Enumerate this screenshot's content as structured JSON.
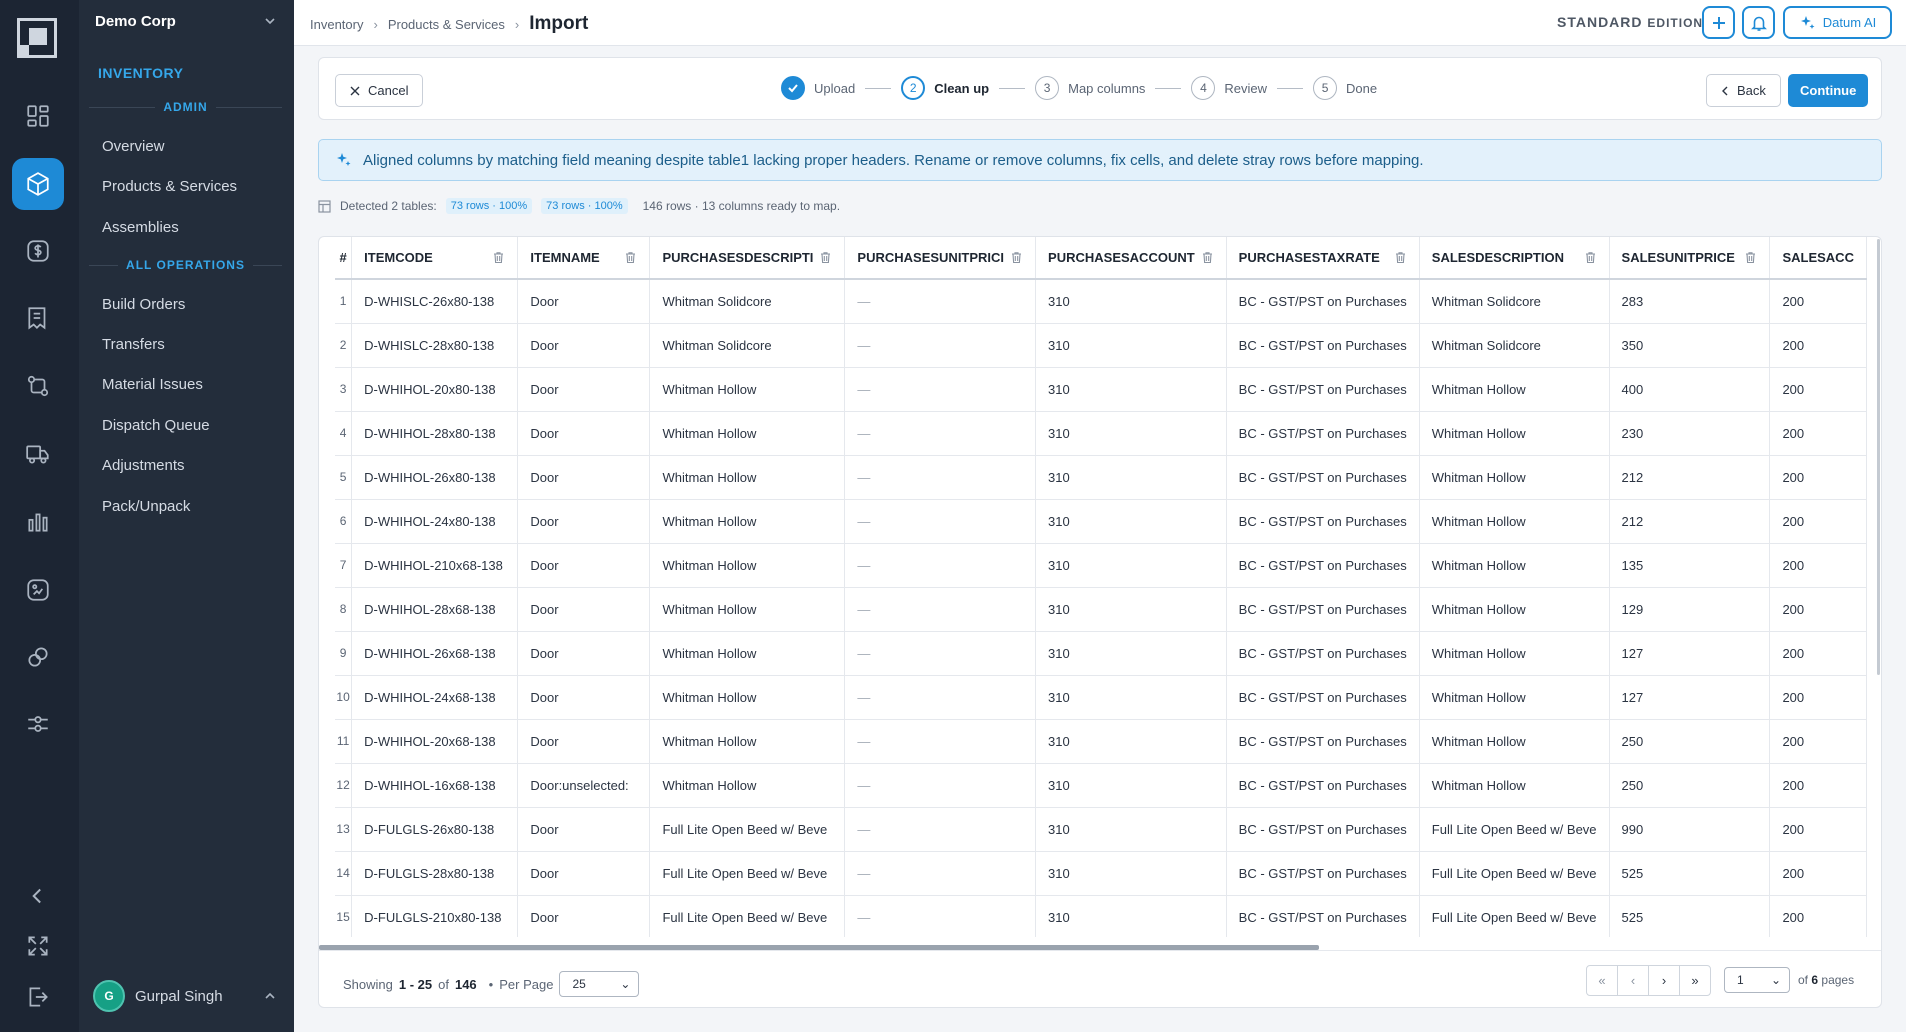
{
  "app": {
    "org": "Demo Corp",
    "section": "INVENTORY",
    "edition": "STANDARD",
    "edition_suffix": "EDITION",
    "ai_label": "Datum AI"
  },
  "user": {
    "initial": "G",
    "name": "Gurpal Singh"
  },
  "nav": {
    "admin_heading": "ADMIN",
    "admin_items": [
      "Overview",
      "Products & Services",
      "Assemblies"
    ],
    "ops_heading": "ALL OPERATIONS",
    "ops_items": [
      "Build Orders",
      "Transfers",
      "Material Issues",
      "Dispatch Queue",
      "Adjustments",
      "Pack/Unpack"
    ]
  },
  "breadcrumb": [
    "Inventory",
    "Products & Services",
    "Import"
  ],
  "wizard": {
    "cancel": "Cancel",
    "back": "Back",
    "continue": "Continue",
    "steps": [
      {
        "num": "",
        "label": "Upload"
      },
      {
        "num": "2",
        "label": "Clean up"
      },
      {
        "num": "3",
        "label": "Map columns"
      },
      {
        "num": "4",
        "label": "Review"
      },
      {
        "num": "5",
        "label": "Done"
      }
    ]
  },
  "banner": "Aligned columns by matching field meaning despite table1 lacking proper headers. Rename or remove columns, fix cells, and delete stray rows before mapping.",
  "detect": {
    "label": "Detected 2 tables:",
    "pill1": "73 rows · 100%",
    "pill2": "73 rows · 100%",
    "summary": "146 rows · 13 columns ready to map."
  },
  "table": {
    "columns": [
      "#",
      "ITEMCODE",
      "ITEMNAME",
      "PURCHASESDESCRIPTI",
      "PURCHASESUNITPRICI",
      "PURCHASESACCOUNT",
      "PURCHASESTAXRATE",
      "SALESDESCRIPTION",
      "SALESUNITPRICE",
      "SALESACC"
    ],
    "rows": [
      [
        "1",
        "D-WHISLC-26x80-138",
        "Door",
        "Whitman Solidcore",
        "—",
        "310",
        "BC - GST/PST on Purchases",
        "Whitman Solidcore",
        "283",
        "200"
      ],
      [
        "2",
        "D-WHISLC-28x80-138",
        "Door",
        "Whitman Solidcore",
        "—",
        "310",
        "BC - GST/PST on Purchases",
        "Whitman Solidcore",
        "350",
        "200"
      ],
      [
        "3",
        "D-WHIHOL-20x80-138",
        "Door",
        "Whitman Hollow",
        "—",
        "310",
        "BC - GST/PST on Purchases",
        "Whitman Hollow",
        "400",
        "200"
      ],
      [
        "4",
        "D-WHIHOL-28x80-138",
        "Door",
        "Whitman Hollow",
        "—",
        "310",
        "BC - GST/PST on Purchases",
        "Whitman Hollow",
        "230",
        "200"
      ],
      [
        "5",
        "D-WHIHOL-26x80-138",
        "Door",
        "Whitman Hollow",
        "—",
        "310",
        "BC - GST/PST on Purchases",
        "Whitman Hollow",
        "212",
        "200"
      ],
      [
        "6",
        "D-WHIHOL-24x80-138",
        "Door",
        "Whitman Hollow",
        "—",
        "310",
        "BC - GST/PST on Purchases",
        "Whitman Hollow",
        "212",
        "200"
      ],
      [
        "7",
        "D-WHIHOL-210x68-138",
        "Door",
        "Whitman Hollow",
        "—",
        "310",
        "BC - GST/PST on Purchases",
        "Whitman Hollow",
        "135",
        "200"
      ],
      [
        "8",
        "D-WHIHOL-28x68-138",
        "Door",
        "Whitman Hollow",
        "—",
        "310",
        "BC - GST/PST on Purchases",
        "Whitman Hollow",
        "129",
        "200"
      ],
      [
        "9",
        "D-WHIHOL-26x68-138",
        "Door",
        "Whitman Hollow",
        "—",
        "310",
        "BC - GST/PST on Purchases",
        "Whitman Hollow",
        "127",
        "200"
      ],
      [
        "10",
        "D-WHIHOL-24x68-138",
        "Door",
        "Whitman Hollow",
        "—",
        "310",
        "BC - GST/PST on Purchases",
        "Whitman Hollow",
        "127",
        "200"
      ],
      [
        "11",
        "D-WHIHOL-20x68-138",
        "Door",
        "Whitman Hollow",
        "—",
        "310",
        "BC - GST/PST on Purchases",
        "Whitman Hollow",
        "250",
        "200"
      ],
      [
        "12",
        "D-WHIHOL-16x68-138",
        "Door:unselected:",
        "Whitman Hollow",
        "—",
        "310",
        "BC - GST/PST on Purchases",
        "Whitman Hollow",
        "250",
        "200"
      ],
      [
        "13",
        "D-FULGLS-26x80-138",
        "Door",
        "Full Lite Open Beed w/ Beve",
        "—",
        "310",
        "BC - GST/PST on Purchases",
        "Full Lite Open Beed w/ Beve",
        "990",
        "200"
      ],
      [
        "14",
        "D-FULGLS-28x80-138",
        "Door",
        "Full Lite Open Beed w/ Beve",
        "—",
        "310",
        "BC - GST/PST on Purchases",
        "Full Lite Open Beed w/ Beve",
        "525",
        "200"
      ],
      [
        "15",
        "D-FULGLS-210x80-138",
        "Door",
        "Full Lite Open Beed w/ Beve",
        "—",
        "310",
        "BC - GST/PST on Purchases",
        "Full Lite Open Beed w/ Beve",
        "525",
        "200"
      ]
    ]
  },
  "footer": {
    "showing": "Showing",
    "range": "1 - 25",
    "of": "of",
    "total": "146",
    "per_page": "Per Page",
    "per_page_value": "25",
    "page_value": "1",
    "of_pages_prefix": "of",
    "page_count": "6",
    "pages_suffix": "pages"
  },
  "pager_icons": [
    "«",
    "‹",
    "›",
    "»"
  ]
}
